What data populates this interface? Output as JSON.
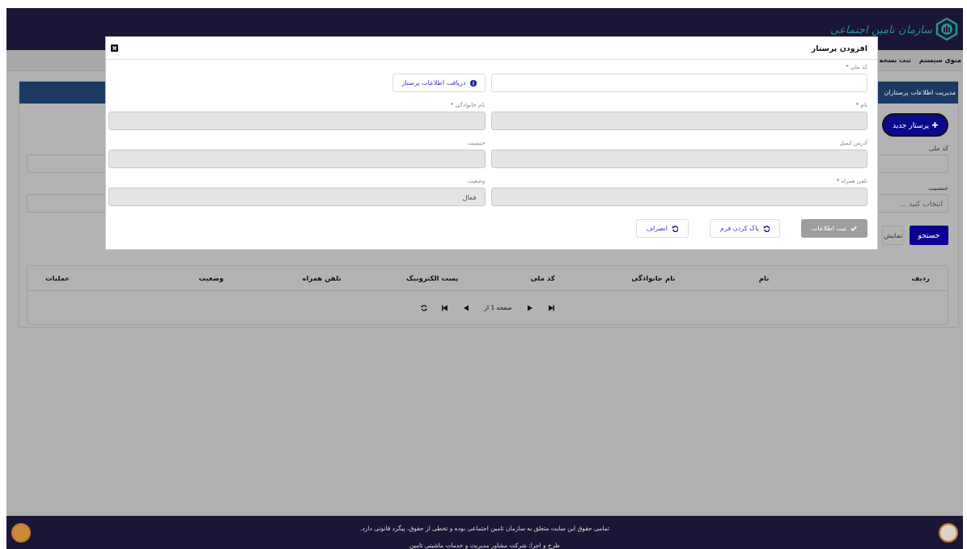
{
  "header": {
    "logo_text": "سازمان تامین اجتماعی"
  },
  "nav": {
    "items": [
      {
        "label": "منوی سیستم"
      },
      {
        "label": "ثبت نسخه"
      }
    ]
  },
  "panel": {
    "title": "مدیریت اطلاعات پرستاران",
    "new_button": "پرستار جدید",
    "filters": [
      {
        "label": "کد ملی",
        "kind": "input"
      },
      {
        "label": "جنسیت",
        "kind": "select",
        "placeholder": "انتخاب کنید ..."
      }
    ],
    "search_button": "جستجو",
    "show_button": "نمایش",
    "table": {
      "columns": [
        "ردیف",
        "نام",
        "نام خانوادگی",
        "کد ملی",
        "پست الکترونیک",
        "تلفن همراه",
        "وضعیت",
        "عملیات"
      ],
      "pager_text": "صفحه 1 از"
    }
  },
  "modal": {
    "title": "افزودن پرستار",
    "required_mark": "*",
    "fields": [
      {
        "kind": "input",
        "label": "کد ملی",
        "required": true,
        "disabled": false
      },
      {
        "kind": "button",
        "label": "دریافت اطلاعات پرستار"
      },
      {
        "kind": "input",
        "label": "نام",
        "required": true,
        "disabled": true
      },
      {
        "kind": "input",
        "label": "نام خانوادگی",
        "required": true,
        "disabled": true
      },
      {
        "kind": "input",
        "label": "آدرس ایمیل",
        "required": false,
        "disabled": true
      },
      {
        "kind": "input",
        "label": "جنسیت",
        "required": false,
        "disabled": true
      },
      {
        "kind": "input",
        "label": "تلفن همراه",
        "required": true,
        "disabled": true
      },
      {
        "kind": "input",
        "label": "وضعیت",
        "required": false,
        "disabled": true,
        "value": "فعال"
      }
    ],
    "actions": [
      {
        "label": "ثبت اطلاعات",
        "kind": "submit",
        "disabled": true
      },
      {
        "label": "پاک کردن فرم",
        "kind": "reset"
      },
      {
        "label": "انصراف",
        "kind": "cancel"
      }
    ]
  },
  "footer": {
    "lines": [
      "تمامی حقوق این سایت متعلق به سازمان تامین اجتماعی بوده و تخطی از حقوق، پیگرد قانونی دارد.",
      "طرح و اجرا: شرکت مشاور مدیریت و خدمات ماشینی تامین"
    ]
  }
}
